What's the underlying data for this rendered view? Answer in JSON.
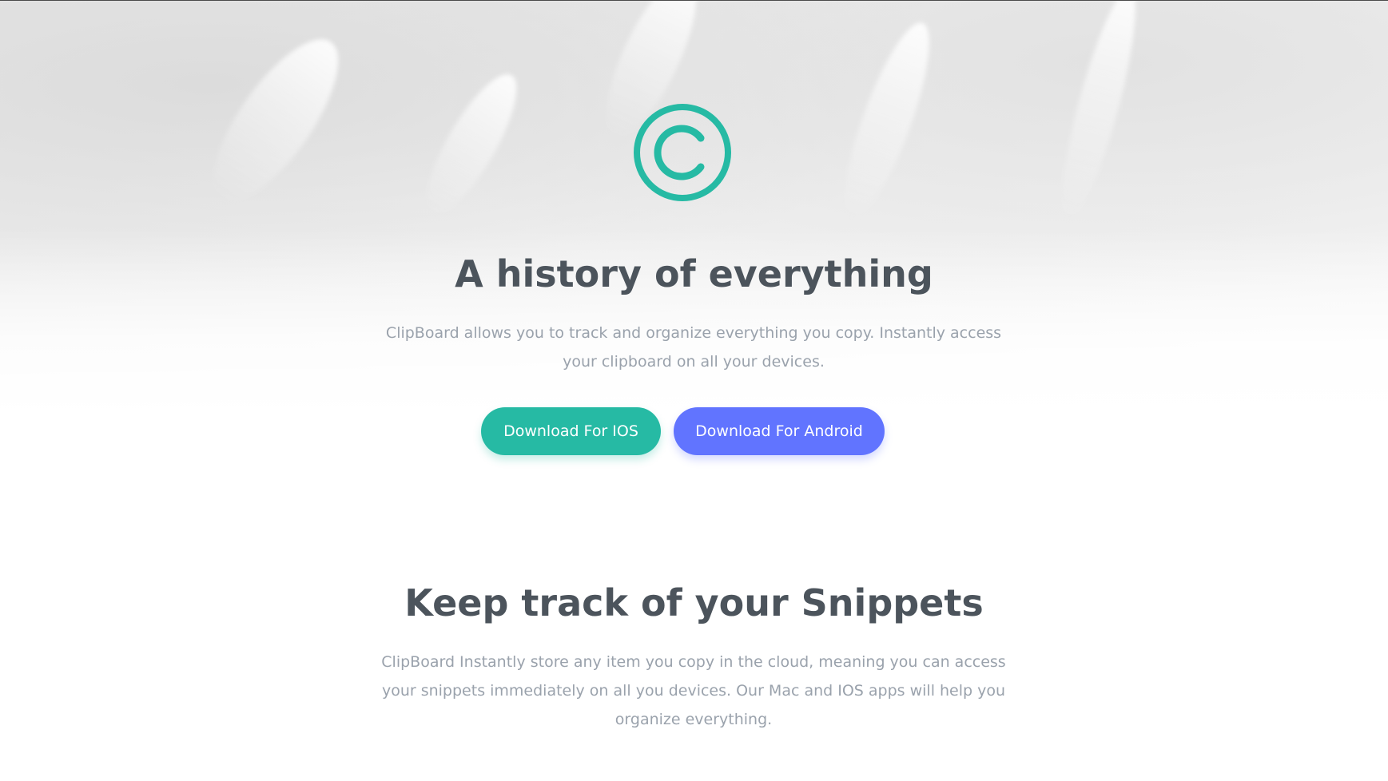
{
  "hero": {
    "logo_icon": "copyright-circle-icon",
    "title": "A history of everything",
    "description": "ClipBoard allows you to track and organize everything you copy. Instantly access your clipboard on all your devices.",
    "buttons": {
      "ios": "Download For IOS",
      "android": "Download For Android"
    }
  },
  "snippets": {
    "title": "Keep track of your Snippets",
    "description": "ClipBoard Instantly store any item you copy in the cloud, meaning you can access your snippets immediately on all you devices. Our Mac and IOS apps will help you organize everything."
  },
  "colors": {
    "accent_teal": "#26baa4",
    "accent_blue": "#6174ff",
    "heading": "#4c545c",
    "body_text": "#9aa2ac"
  }
}
